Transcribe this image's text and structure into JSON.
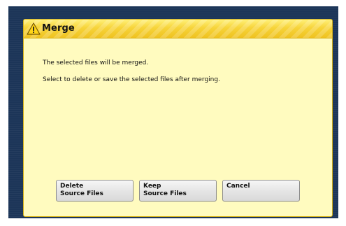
{
  "dialog": {
    "title": "Merge",
    "icon": "warning-icon",
    "message_line_1": "The selected files will be merged.",
    "message_line_2": "Select to delete or save the selected files after merging."
  },
  "buttons": {
    "delete": {
      "line1": "Delete",
      "line2": "Source Files"
    },
    "keep": {
      "line1": "Keep",
      "line2": "Source Files"
    },
    "cancel": {
      "line1": "Cancel",
      "line2": ""
    }
  },
  "colors": {
    "background": "#1c3558",
    "dialog_body": "#fffbbf",
    "titlebar": "#f7d43a",
    "button": "#e4e4e4"
  }
}
